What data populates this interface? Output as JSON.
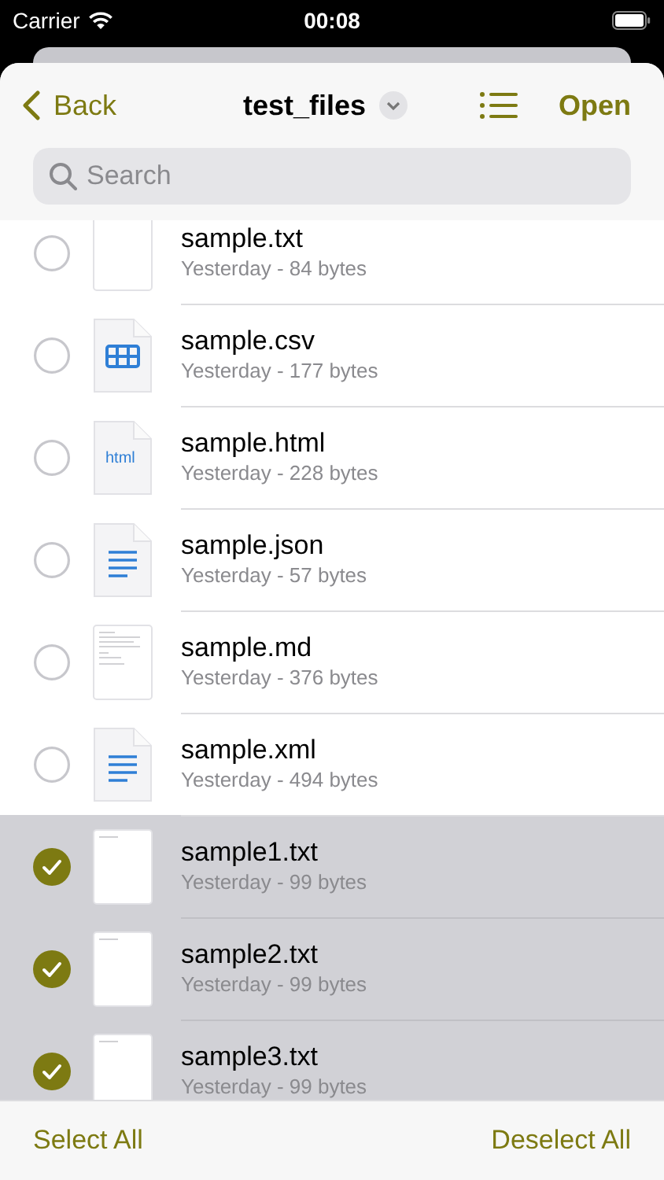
{
  "status_bar": {
    "carrier": "Carrier",
    "time": "00:08"
  },
  "nav": {
    "back": "Back",
    "title": "test_files",
    "action": "Open"
  },
  "search": {
    "placeholder": "Search"
  },
  "files": [
    {
      "name": "sample.txt",
      "detail": "Yesterday - 84 bytes",
      "kind": "blank",
      "selected": false
    },
    {
      "name": "sample.csv",
      "detail": "Yesterday - 177 bytes",
      "kind": "table",
      "selected": false
    },
    {
      "name": "sample.html",
      "detail": "Yesterday - 228 bytes",
      "kind": "label",
      "icon_label": "html",
      "selected": false
    },
    {
      "name": "sample.json",
      "detail": "Yesterday - 57 bytes",
      "kind": "lines",
      "selected": false
    },
    {
      "name": "sample.md",
      "detail": "Yesterday - 376 bytes",
      "kind": "preview",
      "selected": false
    },
    {
      "name": "sample.xml",
      "detail": "Yesterday - 494 bytes",
      "kind": "lines",
      "selected": false
    },
    {
      "name": "sample1.txt",
      "detail": "Yesterday - 99 bytes",
      "kind": "thumb",
      "selected": true
    },
    {
      "name": "sample2.txt",
      "detail": "Yesterday - 99 bytes",
      "kind": "thumb",
      "selected": true
    },
    {
      "name": "sample3.txt",
      "detail": "Yesterday - 99 bytes",
      "kind": "thumb",
      "selected": true
    }
  ],
  "toolbar": {
    "left": "Select All",
    "right": "Deselect All"
  }
}
